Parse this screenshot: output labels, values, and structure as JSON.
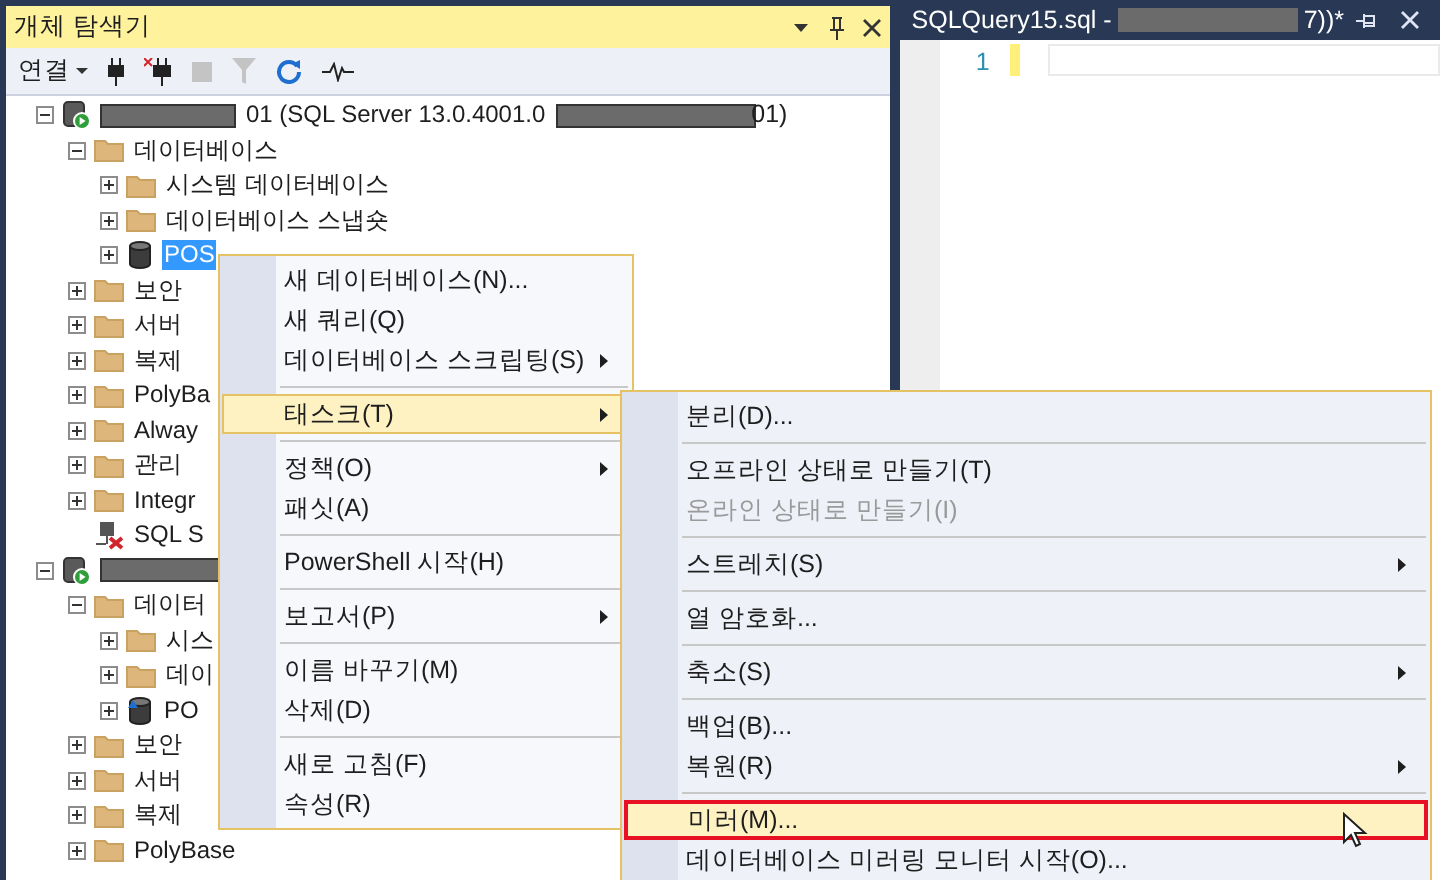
{
  "explorer": {
    "title": "개체 탐색기",
    "toolbar": {
      "connect_label": "연결"
    },
    "tree": [
      {
        "kind": "server",
        "label": "01 (SQL Server 13.0.4001.0",
        "suffix": "01)",
        "expanded": true,
        "children": [
          {
            "kind": "folder",
            "label": "데이터베이스",
            "expanded": true,
            "children": [
              {
                "kind": "folder",
                "label": "시스템 데이터베이스",
                "expanded": false
              },
              {
                "kind": "folder",
                "label": "데이터베이스 스냅숏",
                "expanded": false
              },
              {
                "kind": "database",
                "label": "POS",
                "expanded": false,
                "selected": true
              }
            ]
          },
          {
            "kind": "folder",
            "label": "보안",
            "expanded": false
          },
          {
            "kind": "folder",
            "label": "서버",
            "expanded": false
          },
          {
            "kind": "folder",
            "label": "복제",
            "expanded": false
          },
          {
            "kind": "folder",
            "label": "PolyBa",
            "expanded": false
          },
          {
            "kind": "folder",
            "label": "Alway",
            "expanded": false
          },
          {
            "kind": "folder",
            "label": "관리",
            "expanded": false
          },
          {
            "kind": "folder",
            "label": "Integr",
            "expanded": false
          },
          {
            "kind": "agent",
            "label": "SQL S"
          }
        ]
      },
      {
        "kind": "server",
        "expanded": true,
        "children": [
          {
            "kind": "folder",
            "label": "데이터",
            "expanded": true,
            "children": [
              {
                "kind": "folder",
                "label": "시스",
                "expanded": false
              },
              {
                "kind": "folder",
                "label": "데이",
                "expanded": false
              },
              {
                "kind": "database_mirror",
                "label": "PO",
                "expanded": false,
                "selected": false
              }
            ]
          },
          {
            "kind": "folder",
            "label": "보안",
            "expanded": false
          },
          {
            "kind": "folder",
            "label": "서버",
            "expanded": false
          },
          {
            "kind": "folder",
            "label": "복제",
            "expanded": false
          },
          {
            "kind": "folder",
            "label": "PolyBase",
            "expanded": false
          }
        ]
      }
    ]
  },
  "editor": {
    "tab_title": "SQLQuery15.sql -",
    "tab_suffix": "7))*",
    "line_number": "1"
  },
  "context_menu": {
    "groups": [
      [
        {
          "label": "새 데이터베이스(N)...",
          "submenu": false,
          "selected": false
        },
        {
          "label": "새 쿼리(Q)",
          "submenu": false,
          "selected": false
        },
        {
          "label": "데이터베이스 스크립팅(S)",
          "submenu": true,
          "selected": false
        }
      ],
      [
        {
          "label": "태스크(T)",
          "submenu": true,
          "selected": true
        }
      ],
      [
        {
          "label": "정책(O)",
          "submenu": true,
          "selected": false
        },
        {
          "label": "패싯(A)",
          "submenu": false,
          "selected": false
        }
      ],
      [
        {
          "label": "PowerShell 시작(H)",
          "submenu": false,
          "selected": false
        }
      ],
      [
        {
          "label": "보고서(P)",
          "submenu": true,
          "selected": false
        }
      ],
      [
        {
          "label": "이름 바꾸기(M)",
          "submenu": false,
          "selected": false
        },
        {
          "label": "삭제(D)",
          "submenu": false,
          "selected": false
        }
      ],
      [
        {
          "label": "새로 고침(F)",
          "submenu": false,
          "selected": false
        },
        {
          "label": "속성(R)",
          "submenu": false,
          "selected": false
        }
      ]
    ]
  },
  "submenu": {
    "groups": [
      [
        {
          "label": "분리(D)...",
          "submenu": false,
          "selected": false,
          "disabled": false
        }
      ],
      [
        {
          "label": "오프라인 상태로 만들기(T)",
          "submenu": false,
          "selected": false,
          "disabled": false
        },
        {
          "label": "온라인 상태로 만들기(I)",
          "submenu": false,
          "selected": false,
          "disabled": true
        }
      ],
      [
        {
          "label": "스트레치(S)",
          "submenu": true,
          "selected": false,
          "disabled": false
        }
      ],
      [
        {
          "label": "열 암호화...",
          "submenu": false,
          "selected": false,
          "disabled": false
        }
      ],
      [
        {
          "label": "축소(S)",
          "submenu": true,
          "selected": false,
          "disabled": false
        }
      ],
      [
        {
          "label": "백업(B)...",
          "submenu": false,
          "selected": false,
          "disabled": false
        },
        {
          "label": "복원(R)",
          "submenu": true,
          "selected": false,
          "disabled": false
        }
      ],
      [
        {
          "label": "미러(M)...",
          "submenu": false,
          "selected": true,
          "disabled": false,
          "annotated": true
        },
        {
          "label": "데이터베이스 미러링 모니터 시작(O)...",
          "submenu": false,
          "selected": false,
          "disabled": false
        }
      ]
    ]
  }
}
